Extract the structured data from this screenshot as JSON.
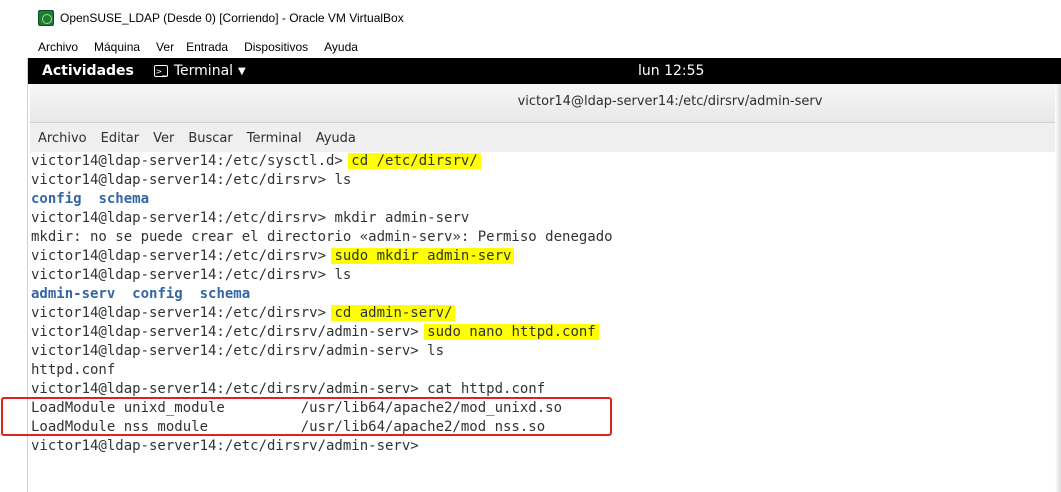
{
  "virtualbox": {
    "title": "OpenSUSE_LDAP (Desde 0) [Corriendo] - Oracle VM VirtualBox",
    "menu": [
      "Archivo",
      "Máquina",
      "Ver",
      "Entrada",
      "Dispositivos",
      "Ayuda"
    ]
  },
  "gnome": {
    "activities": "Actividades",
    "app_menu": "Terminal",
    "clock": "lun 12:55"
  },
  "terminal": {
    "title": "victor14@ldap-server14:/etc/dirsrv/admin-serv",
    "menu": [
      "Archivo",
      "Editar",
      "Ver",
      "Buscar",
      "Terminal",
      "Ayuda"
    ],
    "lines": [
      {
        "prompt": "victor14@ldap-server14:/etc/sysctl.d> ",
        "cmd": "cd /etc/dirsrv/"
      },
      {
        "prompt": "victor14@ldap-server14:/etc/dirsrv> ",
        "cmd": "ls"
      },
      {
        "dirs": [
          "config",
          "schema"
        ]
      },
      {
        "prompt": "victor14@ldap-server14:/etc/dirsrv> ",
        "cmd": "mkdir admin-serv"
      },
      {
        "out": "mkdir: no se puede crear el directorio «admin-serv»: Permiso denegado"
      },
      {
        "prompt": "victor14@ldap-server14:/etc/dirsrv> ",
        "cmd": "sudo mkdir admin-serv"
      },
      {
        "prompt": "victor14@ldap-server14:/etc/dirsrv> ",
        "cmd": "ls"
      },
      {
        "dirs": [
          "admin-serv",
          "config",
          "schema"
        ]
      },
      {
        "prompt": "victor14@ldap-server14:/etc/dirsrv> ",
        "cmd": "cd admin-serv/"
      },
      {
        "prompt": "victor14@ldap-server14:/etc/dirsrv/admin-serv> ",
        "cmd": "sudo nano httpd.conf"
      },
      {
        "prompt": "victor14@ldap-server14:/etc/dirsrv/admin-serv> ",
        "cmd": "ls"
      },
      {
        "out": "httpd.conf"
      },
      {
        "prompt": "victor14@ldap-server14:/etc/dirsrv/admin-serv> ",
        "cmd": "cat httpd.conf"
      },
      {
        "out": "LoadModule unixd_module         /usr/lib64/apache2/mod_unixd.so"
      },
      {
        "out": "LoadModule nss_module           /usr/lib64/apache2/mod_nss.so"
      },
      {
        "prompt": "victor14@ldap-server14:/etc/dirsrv/admin-serv> ",
        "cmd": ""
      }
    ]
  }
}
